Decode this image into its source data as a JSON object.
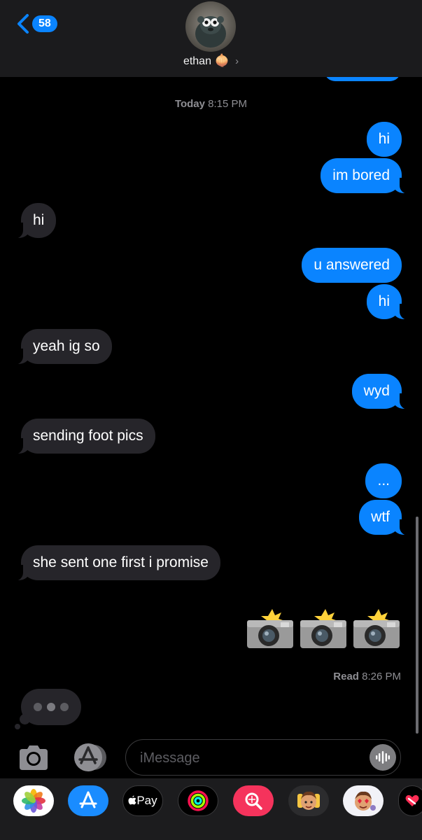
{
  "header": {
    "back_count": "58",
    "contact_name": "ethan",
    "contact_emoji": "🧅"
  },
  "conversation": {
    "timestamp_day": "Today",
    "timestamp_time": "8:15 PM",
    "messages": [
      {
        "from": "me",
        "text": "hi"
      },
      {
        "from": "me",
        "text": "im bored"
      },
      {
        "from": "them",
        "text": "hi"
      },
      {
        "from": "me",
        "text": "u answered"
      },
      {
        "from": "me",
        "text": "hi"
      },
      {
        "from": "them",
        "text": "yeah ig so"
      },
      {
        "from": "me",
        "text": "wyd"
      },
      {
        "from": "them",
        "text": "sending foot pics"
      },
      {
        "from": "me",
        "text": "..."
      },
      {
        "from": "me",
        "text": "wtf"
      },
      {
        "from": "them",
        "text": "she sent one first i promise"
      }
    ],
    "emoji_message": [
      "camera-with-flash-emoji",
      "camera-with-flash-emoji",
      "camera-with-flash-emoji"
    ],
    "read_label": "Read",
    "read_time": "8:26 PM"
  },
  "composer": {
    "placeholder": "iMessage"
  },
  "app_drawer": {
    "apple_pay_label": "Pay",
    "apps": [
      "photos-app-icon",
      "app-store-icon",
      "apple-pay-icon",
      "fitness-icon",
      "search-images-icon",
      "memoji-icon",
      "memoji-stickers-icon",
      "digital-touch-icon"
    ]
  },
  "colors": {
    "outgoing": "#0a84ff",
    "incoming": "#26252a",
    "background": "#000000",
    "header": "#1b1b1d"
  }
}
